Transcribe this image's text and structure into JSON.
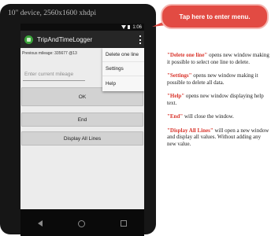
{
  "heading": "10\" device, 2560x1600 xhdpi",
  "status_bar": {
    "time": "1:06"
  },
  "app": {
    "title": "TripAndTimeLogger"
  },
  "content": {
    "previous_mileage": "Previous mileage: 335677  @13",
    "mileage_placeholder": "Enter current mileage",
    "ok_label": "OK",
    "end_label": "End",
    "display_label": "Display All Lines"
  },
  "menu": {
    "items": [
      {
        "label": "Delete one line"
      },
      {
        "label": "Settings"
      },
      {
        "label": "Help"
      }
    ]
  },
  "callout": "Tap here to enter menu.",
  "notes": [
    {
      "term": "\"Delete one line\"",
      "text": " opens new window making it possible to select one line to delete."
    },
    {
      "term": "\"Settings\"",
      "text": " opens new window making it possible to delete all data."
    },
    {
      "term": "\"Help\"",
      "text": " opens new window displaying help text."
    },
    {
      "term": "\"End\"",
      "text": " will close the window."
    },
    {
      "term": "\"Display All Lines\"",
      "text": " will open a new window and display all values. Without adding any new value."
    }
  ],
  "colors": {
    "accent": "#e24b43",
    "app_icon": "#3aa33a"
  }
}
